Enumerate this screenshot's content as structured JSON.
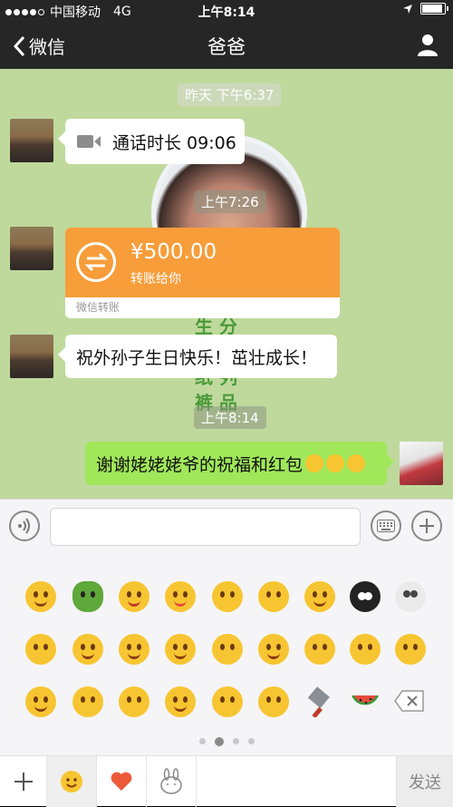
{
  "status_bar": {
    "carrier": "中国移动",
    "network": "4G",
    "time": "上午8:14",
    "battery_level": 0.9
  },
  "nav": {
    "back_label": "微信",
    "title": "爸爸"
  },
  "messages": {
    "ts_yesterday": "昨天 下午6:37",
    "call_text": "通话时长 09:06",
    "ts_726": "上午7:26",
    "transfer_amount": "¥500.00",
    "transfer_sub": "转账给你",
    "transfer_footer": "微信转账",
    "birthday_text": "祝外孙子生日快乐！茁壮成长！",
    "ts_814": "上午8:14",
    "thanks_text": "谢谢姥姥姥爷的祝福和红包"
  },
  "colors": {
    "nav_bg": "#262626",
    "chat_bg": "#bfd99c",
    "transfer_orange": "#f79d3a",
    "sent_bubble": "#a0e75a"
  },
  "emoji_page": {
    "current": 2,
    "total": 4
  },
  "tabbar": {
    "send_label": "发送"
  }
}
